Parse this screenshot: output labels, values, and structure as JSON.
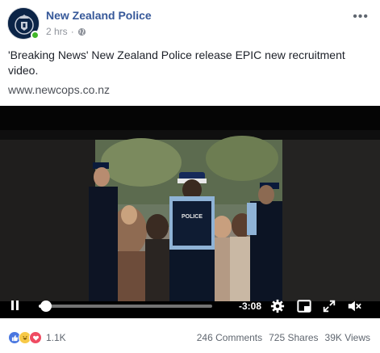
{
  "header": {
    "page_name": "New Zealand Police",
    "time": "2 hrs",
    "separator": "·",
    "privacy_icon": "globe-icon",
    "more_icon": "ellipsis-icon"
  },
  "post": {
    "text": "'Breaking News' New Zealand Police release EPIC new recruitment video.",
    "link": "www.newcops.co.nz"
  },
  "video": {
    "scene_text": "POLICE",
    "progress_fraction": 0.02,
    "time_remaining": "-3:08",
    "controls": [
      "pause-icon",
      "gear-icon",
      "pip-icon",
      "fullscreen-icon",
      "volume-icon"
    ]
  },
  "footer": {
    "reaction_icons": [
      "like-icon",
      "haha-icon",
      "love-icon"
    ],
    "reaction_count": "1.1K",
    "comments": "246 Comments",
    "shares": "725 Shares",
    "views": "39K Views"
  },
  "colors": {
    "page_name": "#365899",
    "online": "#42b72a",
    "like": "#4a77e0",
    "haha": "#f7c948",
    "love": "#ef4b62"
  }
}
